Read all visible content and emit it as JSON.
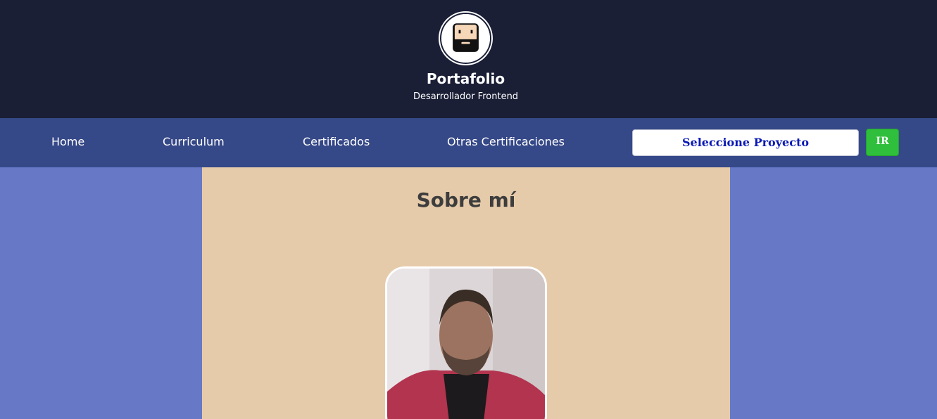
{
  "header": {
    "title": "Portafolio",
    "subtitle": "Desarrollador Frontend",
    "avatar_icon": "bearded-face-avatar-icon"
  },
  "nav": {
    "links": [
      {
        "label": "Home"
      },
      {
        "label": "Curriculum"
      },
      {
        "label": "Certificados"
      },
      {
        "label": "Otras Certificaciones"
      }
    ],
    "project_select": {
      "selected": "Seleccione Proyecto"
    },
    "go_button": {
      "label": "IR"
    }
  },
  "main": {
    "section_title": "Sobre mí",
    "photo": "profile-photo"
  },
  "colors": {
    "header_bg": "#1a1f36",
    "nav_bg": "#354887",
    "page_bg": "#6678c6",
    "content_bg": "#e6cbaa",
    "select_text": "#0a19b5",
    "go_button_bg": "#2fbf3c"
  }
}
